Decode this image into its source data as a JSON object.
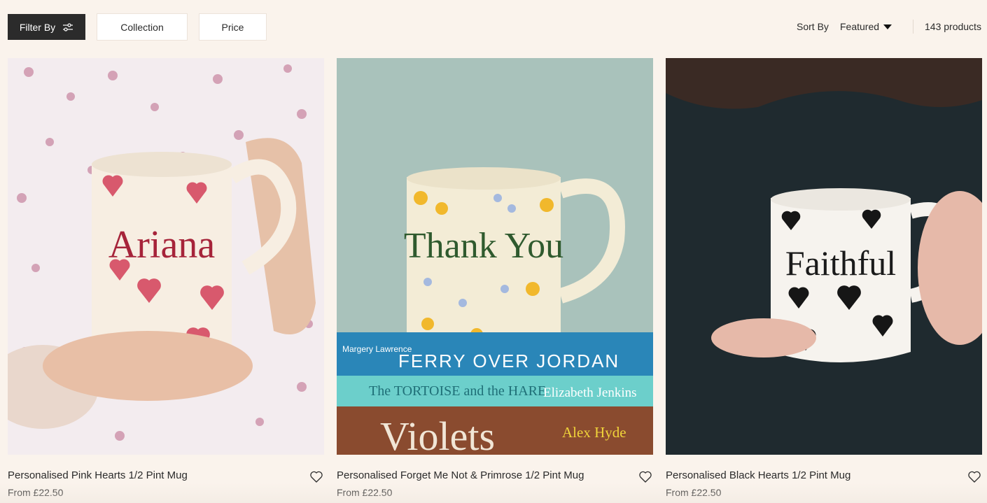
{
  "toolbar": {
    "filter_label": "Filter By",
    "collection_label": "Collection",
    "price_label": "Price",
    "sort_label": "Sort By",
    "sort_value": "Featured",
    "product_count": "143 products"
  },
  "products": [
    {
      "title": "Personalised Pink Hearts 1/2 Pint Mug",
      "price": "From £22.50",
      "mug_text": "Ariana"
    },
    {
      "title": "Personalised Forget Me Not & Primrose 1/2 Pint Mug",
      "price": "From £22.50",
      "mug_text": "Thank You",
      "books": [
        {
          "author": "Margery Lawrence",
          "title": "FERRY OVER JORDAN"
        },
        {
          "title": "The TORTOISE and the HARE",
          "author": "Elizabeth Jenkins"
        },
        {
          "title": "Violets",
          "author": "Alex Hyde"
        }
      ]
    },
    {
      "title": "Personalised Black Hearts 1/2 Pint Mug",
      "price": "From £22.50",
      "mug_text": "Faithful"
    }
  ],
  "icons": {
    "filter": "sliders-icon",
    "sort": "caret-down-icon",
    "wishlist": "heart-outline-icon"
  },
  "colors": {
    "background": "#faf3ec",
    "filter_button": "#2b2b2b"
  }
}
